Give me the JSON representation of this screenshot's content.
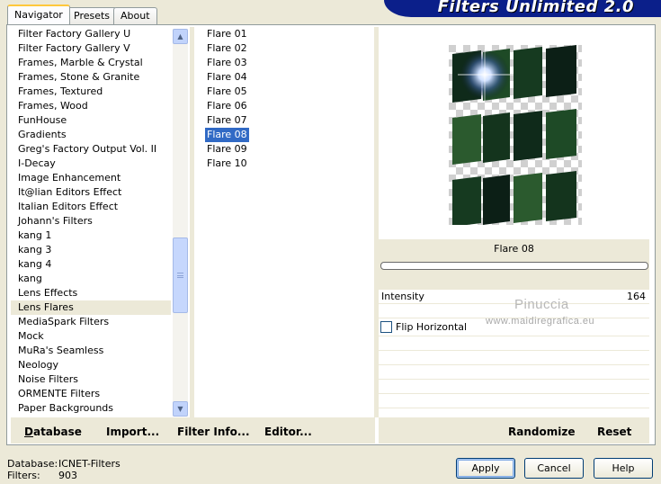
{
  "tabs": [
    "Navigator",
    "Presets",
    "About"
  ],
  "banner_title": "Filters Unlimited 2.0",
  "categories": [
    "Filter Factory Gallery U",
    "Filter Factory Gallery V",
    "Frames, Marble & Crystal",
    "Frames, Stone & Granite",
    "Frames, Textured",
    "Frames, Wood",
    "FunHouse",
    "Gradients",
    "Greg's Factory Output Vol. II",
    "I-Decay",
    "Image Enhancement",
    "It@lian Editors Effect",
    "Italian Editors Effect",
    "Johann's Filters",
    "kang 1",
    "kang 3",
    "kang 4",
    "kang",
    "Lens Effects",
    "Lens Flares",
    "MediaSpark Filters",
    "Mock",
    "MuRa's Seamless",
    "Neology",
    "Noise Filters",
    "ORMENTE Filters",
    "Paper Backgrounds"
  ],
  "selected_category": "Lens Flares",
  "effects": [
    "Flare 01",
    "Flare 02",
    "Flare 03",
    "Flare 04",
    "Flare 05",
    "Flare 06",
    "Flare 07",
    "Flare 08",
    "Flare 09",
    "Flare 10"
  ],
  "selected_effect": "Flare 08",
  "links": {
    "database": "Database",
    "import": "Import...",
    "filter_info": "Filter Info...",
    "editor": "Editor...",
    "randomize": "Randomize",
    "reset": "Reset"
  },
  "preview_label": "Flare 08",
  "progress_fraction": 0,
  "params": {
    "intensity_label": "Intensity",
    "intensity_value": "164",
    "flip_label": "Flip Horizontal",
    "flip_checked": false
  },
  "watermark": {
    "line1": "Pinuccia",
    "line2": "www.maidiregrafica.eu"
  },
  "footer": {
    "database_label": "Database:",
    "database_value": "ICNET-Filters",
    "filters_label": "Filters:",
    "filters_value": "903"
  },
  "buttons": {
    "apply": "Apply",
    "cancel": "Cancel",
    "help": "Help"
  },
  "colors": {
    "banner": "#0b1f8a",
    "selection": "#316ac5",
    "face": "#ece9d8"
  }
}
